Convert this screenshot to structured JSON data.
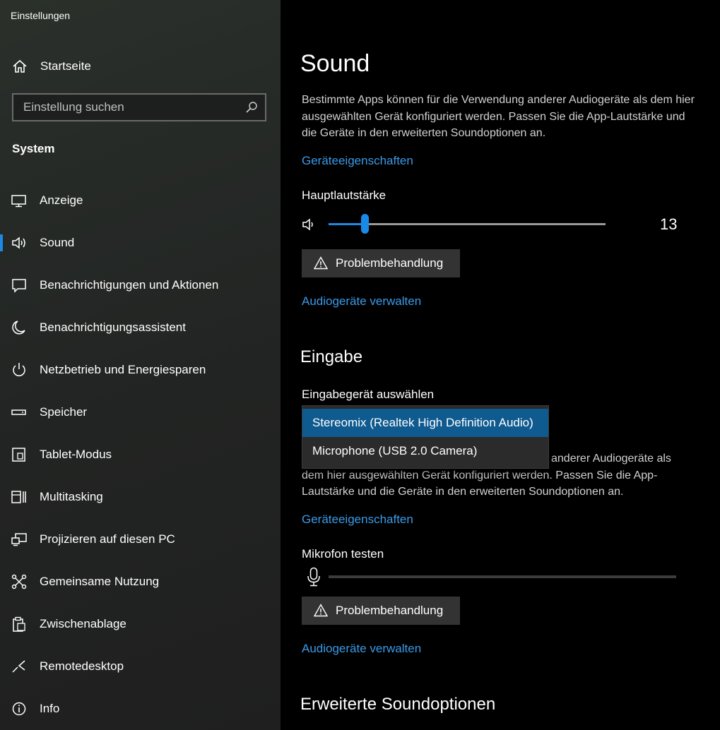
{
  "app": {
    "title": "Einstellungen"
  },
  "sidebar": {
    "home_label": "Startseite",
    "search_placeholder": "Einstellung suchen",
    "section_label": "System",
    "items": [
      {
        "label": "Anzeige",
        "icon": "monitor-icon"
      },
      {
        "label": "Sound",
        "icon": "speaker-icon",
        "selected": true
      },
      {
        "label": "Benachrichtigungen und Aktionen",
        "icon": "notification-icon"
      },
      {
        "label": "Benachrichtigungsassistent",
        "icon": "moon-icon"
      },
      {
        "label": "Netzbetrieb und Energiesparen",
        "icon": "power-icon"
      },
      {
        "label": "Speicher",
        "icon": "storage-icon"
      },
      {
        "label": "Tablet-Modus",
        "icon": "tablet-mode-icon"
      },
      {
        "label": "Multitasking",
        "icon": "multitasking-icon"
      },
      {
        "label": "Projizieren auf diesen PC",
        "icon": "project-icon"
      },
      {
        "label": "Gemeinsame Nutzung",
        "icon": "share-icon"
      },
      {
        "label": "Zwischenablage",
        "icon": "clipboard-icon"
      },
      {
        "label": "Remotedesktop",
        "icon": "remote-desktop-icon"
      },
      {
        "label": "Info",
        "icon": "info-icon"
      }
    ]
  },
  "main": {
    "title": "Sound",
    "output": {
      "description": "Bestimmte Apps können für die Verwendung anderer Audiogeräte als dem hier ausgewählten Gerät konfiguriert werden. Passen Sie die App-Lautstärke und die Geräte in den erweiterten Soundoptionen an.",
      "device_properties_link": "Geräteeigenschaften",
      "volume_label": "Hauptlautstärke",
      "volume_value": "13",
      "volume_fraction": 0.13,
      "troubleshoot_label": "Problembehandlung",
      "manage_devices_link": "Audiogeräte verwalten"
    },
    "input": {
      "heading": "Eingabe",
      "select_label": "Eingabegerät auswählen",
      "options": [
        "Stereomix (Realtek High Definition Audio)",
        "Microphone (USB 2.0 Camera)"
      ],
      "description_partial": "anderer Audiogeräte als",
      "description_rest": "dem hier ausgewählten Gerät konfiguriert werden. Passen Sie die App-Lautstärke und die Geräte in den erweiterten Soundoptionen an.",
      "device_properties_link": "Geräteeigenschaften",
      "mic_test_label": "Mikrofon testen",
      "troubleshoot_label": "Problembehandlung",
      "manage_devices_link": "Audiogeräte verwalten"
    },
    "advanced_heading": "Erweiterte Soundoptionen"
  },
  "colors": {
    "accent": "#1a8ae6",
    "link": "#3b9ae8",
    "selected_option": "#0f5a8f"
  }
}
